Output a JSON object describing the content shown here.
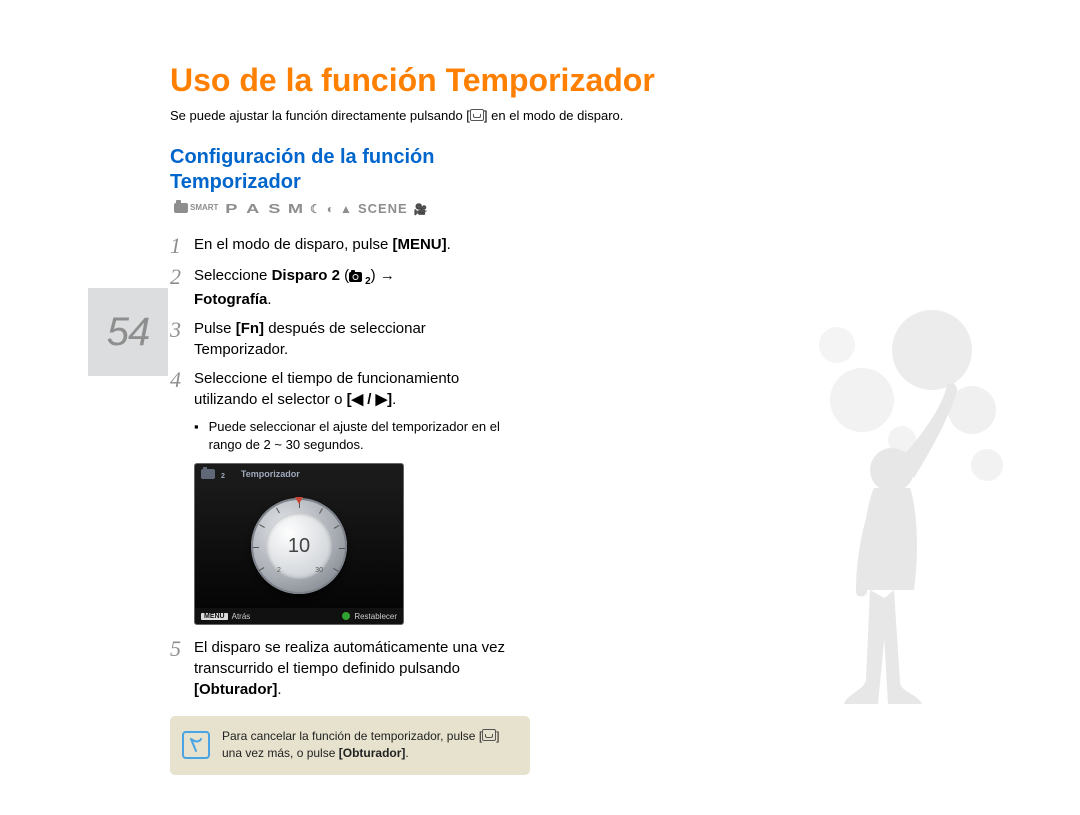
{
  "page": {
    "title": "Uso de la función Temporizador",
    "subtitle_pre": "Se puede ajustar la función directamente pulsando [",
    "subtitle_post": "] en el modo de disparo.",
    "number": "54"
  },
  "section": {
    "heading_line1": "Configuración de la función",
    "heading_line2_word": "Temporizador",
    "modes": {
      "smart": "SMART",
      "p": "P",
      "a": "A",
      "s": "S",
      "m": "M",
      "scene": "SCENE"
    }
  },
  "steps": [
    {
      "num": "1",
      "pre": "En el modo de disparo, pulse ",
      "bold1": "[MENU]",
      "post": "."
    },
    {
      "num": "2",
      "pre": "Seleccione ",
      "bold1": "Disparo 2",
      "mid1": " (",
      "cam_sub": "2",
      "mid2": ")   →",
      "bold2": "Fotografía",
      "post": "."
    },
    {
      "num": "3",
      "pre": "Pulse ",
      "bold1": "[Fn]",
      "post": " después de seleccionar Temporizador."
    },
    {
      "num": "4",
      "text": "Seleccione el tiempo de funcionamiento utilizando el selector o ",
      "bold1": "[◀ / ▶]",
      "post": "."
    },
    {
      "num": "5",
      "text": "El disparo se realiza automáticamente una vez transcurrido el tiempo definido pulsando ",
      "bold1": "[Obturador]",
      "post": "."
    }
  ],
  "bullet": {
    "text": "Puede seleccionar el ajuste del temporizador en el rango de 2 ~ 30 segundos."
  },
  "camera_screen": {
    "tab_sub": "2",
    "title": "Temporizador",
    "value": "10",
    "tick_low": "2",
    "tick_high": "30",
    "menu_badge": "MENU",
    "back": "Atrás",
    "reset": "Restablecer"
  },
  "tip": {
    "text_pre": "Para cancelar la función de temporizador, pulse [",
    "text_mid": "] una vez más, o pulse ",
    "bold1": "[Obturador]",
    "post": "."
  }
}
